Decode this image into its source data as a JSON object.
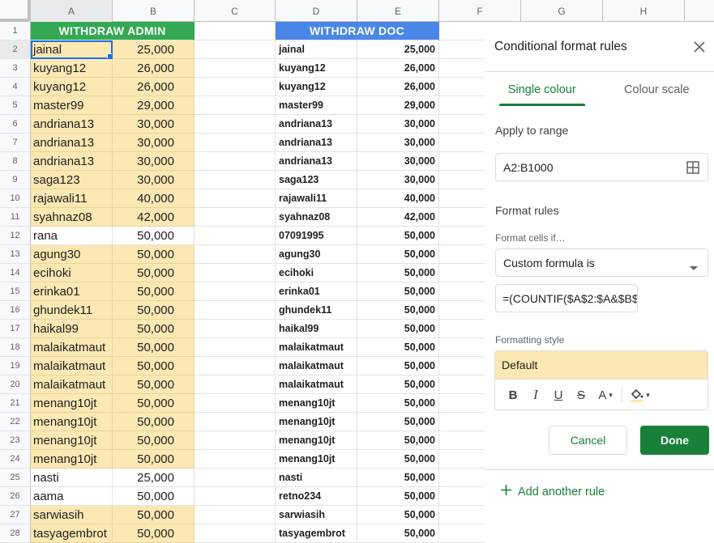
{
  "columns": [
    "A",
    "B",
    "C",
    "D",
    "E",
    "F",
    "G",
    "H"
  ],
  "headers": {
    "admin_title": "WITHDRAW ADMIN",
    "doc_title": "WITHDRAW DOC"
  },
  "colors": {
    "admin_header": "#34a853",
    "doc_header": "#4a86e8",
    "highlight": "#fce8b2",
    "accent_green": "#188038",
    "selection_blue": "#1a73e8"
  },
  "rows": [
    {
      "n": "2",
      "a": "jainal",
      "b": "25,000",
      "hl": true,
      "d": "jainal",
      "e": "25,000"
    },
    {
      "n": "3",
      "a": "kuyang12",
      "b": "26,000",
      "hl": true,
      "d": "kuyang12",
      "e": "26,000"
    },
    {
      "n": "4",
      "a": "kuyang12",
      "b": "26,000",
      "hl": true,
      "d": "kuyang12",
      "e": "26,000"
    },
    {
      "n": "5",
      "a": "master99",
      "b": "29,000",
      "hl": true,
      "d": "master99",
      "e": "29,000"
    },
    {
      "n": "6",
      "a": "andriana13",
      "b": "30,000",
      "hl": true,
      "d": "andriana13",
      "e": "30,000"
    },
    {
      "n": "7",
      "a": "andriana13",
      "b": "30,000",
      "hl": true,
      "d": "andriana13",
      "e": "30,000"
    },
    {
      "n": "8",
      "a": "andriana13",
      "b": "30,000",
      "hl": true,
      "d": "andriana13",
      "e": "30,000"
    },
    {
      "n": "9",
      "a": "saga123",
      "b": "30,000",
      "hl": true,
      "d": "saga123",
      "e": "30,000"
    },
    {
      "n": "10",
      "a": "rajawali11",
      "b": "40,000",
      "hl": true,
      "d": "rajawali11",
      "e": "40,000"
    },
    {
      "n": "11",
      "a": "syahnaz08",
      "b": "42,000",
      "hl": true,
      "d": "syahnaz08",
      "e": "42,000"
    },
    {
      "n": "12",
      "a": "rana",
      "b": "50,000",
      "hl": false,
      "d": "07091995",
      "e": "50,000"
    },
    {
      "n": "13",
      "a": "agung30",
      "b": "50,000",
      "hl": true,
      "d": "agung30",
      "e": "50,000"
    },
    {
      "n": "14",
      "a": "ecihoki",
      "b": "50,000",
      "hl": true,
      "d": "ecihoki",
      "e": "50,000"
    },
    {
      "n": "15",
      "a": "erinka01",
      "b": "50,000",
      "hl": true,
      "d": "erinka01",
      "e": "50,000"
    },
    {
      "n": "16",
      "a": "ghundek11",
      "b": "50,000",
      "hl": true,
      "d": "ghundek11",
      "e": "50,000"
    },
    {
      "n": "17",
      "a": "haikal99",
      "b": "50,000",
      "hl": true,
      "d": "haikal99",
      "e": "50,000"
    },
    {
      "n": "18",
      "a": "malaikatmaut",
      "b": "50,000",
      "hl": true,
      "d": "malaikatmaut",
      "e": "50,000"
    },
    {
      "n": "19",
      "a": "malaikatmaut",
      "b": "50,000",
      "hl": true,
      "d": "malaikatmaut",
      "e": "50,000"
    },
    {
      "n": "20",
      "a": "malaikatmaut",
      "b": "50,000",
      "hl": true,
      "d": "malaikatmaut",
      "e": "50,000"
    },
    {
      "n": "21",
      "a": "menang10jt",
      "b": "50,000",
      "hl": true,
      "d": "menang10jt",
      "e": "50,000"
    },
    {
      "n": "22",
      "a": "menang10jt",
      "b": "50,000",
      "hl": true,
      "d": "menang10jt",
      "e": "50,000"
    },
    {
      "n": "23",
      "a": "menang10jt",
      "b": "50,000",
      "hl": true,
      "d": "menang10jt",
      "e": "50,000"
    },
    {
      "n": "24",
      "a": "menang10jt",
      "b": "50,000",
      "hl": true,
      "d": "menang10jt",
      "e": "50,000"
    },
    {
      "n": "25",
      "a": "nasti",
      "b": "25,000",
      "hl": false,
      "d": "nasti",
      "e": "50,000"
    },
    {
      "n": "26",
      "a": "aama",
      "b": "50,000",
      "hl": false,
      "d": "retno234",
      "e": "50,000"
    },
    {
      "n": "27",
      "a": "sarwiasih",
      "b": "50,000",
      "hl": true,
      "d": "sarwiasih",
      "e": "50,000"
    },
    {
      "n": "28",
      "a": "tasyagembrot",
      "b": "50,000",
      "hl": true,
      "d": "tasyagembrot",
      "e": "50,000"
    }
  ],
  "panel": {
    "title": "Conditional format rules",
    "close_icon": "close-icon",
    "tabs": [
      {
        "label": "Single colour",
        "active": true
      },
      {
        "label": "Colour scale",
        "active": false
      }
    ],
    "apply_to_range_label": "Apply to range",
    "range_value": "A2:B1000",
    "range_icon": "grid-select-icon",
    "format_rules_label": "Format rules",
    "format_cells_if_label": "Format cells if…",
    "condition_value": "Custom formula is",
    "formula_value": "=(COUNTIF($A$2:$A&$B$",
    "formatting_style_label": "Formatting style",
    "style_preview": "Default",
    "toolbar": {
      "bold": "B",
      "italic": "I",
      "underline": "U",
      "strikethrough": "S",
      "text_color": "A"
    },
    "cancel_label": "Cancel",
    "done_label": "Done",
    "add_rule_label": "Add another rule"
  }
}
